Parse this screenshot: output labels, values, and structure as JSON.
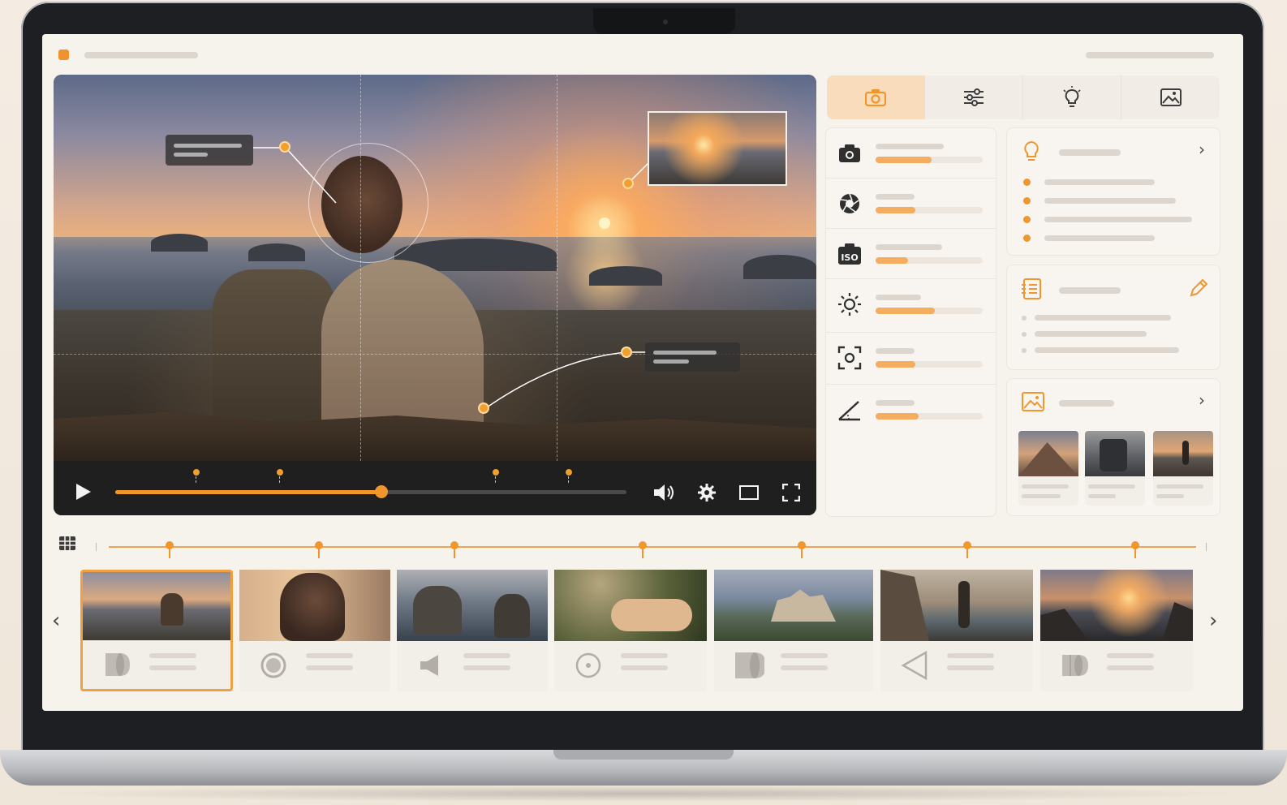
{
  "colors": {
    "accent": "#f0962b",
    "screen_bg": "#f6f2ec",
    "player_bar": "#1f1f20"
  },
  "app": {
    "window_dot": "window-indicator"
  },
  "viewer": {
    "playback_progress": 0.52,
    "markers": 4,
    "controls": [
      "play-icon",
      "volume-icon",
      "settings-icon",
      "aspect-icon",
      "fullscreen-icon"
    ]
  },
  "tabs": [
    {
      "icon": "camera-icon",
      "active": true
    },
    {
      "icon": "sliders-icon",
      "active": false
    },
    {
      "icon": "lightbulb-icon",
      "active": false
    },
    {
      "icon": "image-icon",
      "active": false
    }
  ],
  "settings": [
    {
      "icon": "camera-icon",
      "level": 0.52
    },
    {
      "icon": "aperture-icon",
      "level": 0.37
    },
    {
      "icon": "iso-icon",
      "label": "ISO",
      "level": 0.3
    },
    {
      "icon": "brightness-icon",
      "level": 0.55
    },
    {
      "icon": "focus-icon",
      "level": 0.37
    },
    {
      "icon": "angle-icon",
      "level": 0.4
    }
  ],
  "cards": {
    "tips": {
      "icon": "lightbulb-icon",
      "items": 4
    },
    "notes": {
      "icon": "notebook-icon",
      "items": 3
    },
    "references": {
      "icon": "image-icon",
      "items": 3
    }
  },
  "timeline": {
    "frames": [
      {
        "icon": "cylinder-icon",
        "selected": true
      },
      {
        "icon": "circle-icon",
        "selected": false
      },
      {
        "icon": "speaker-icon",
        "selected": false
      },
      {
        "icon": "target-icon",
        "selected": false
      },
      {
        "icon": "cylinder-icon",
        "selected": false
      },
      {
        "icon": "triangle-icon",
        "selected": false
      },
      {
        "icon": "cylinder-icon",
        "selected": false
      }
    ]
  },
  "labels": {
    "iso": "ISO",
    "prev": "‹",
    "next": "›"
  }
}
